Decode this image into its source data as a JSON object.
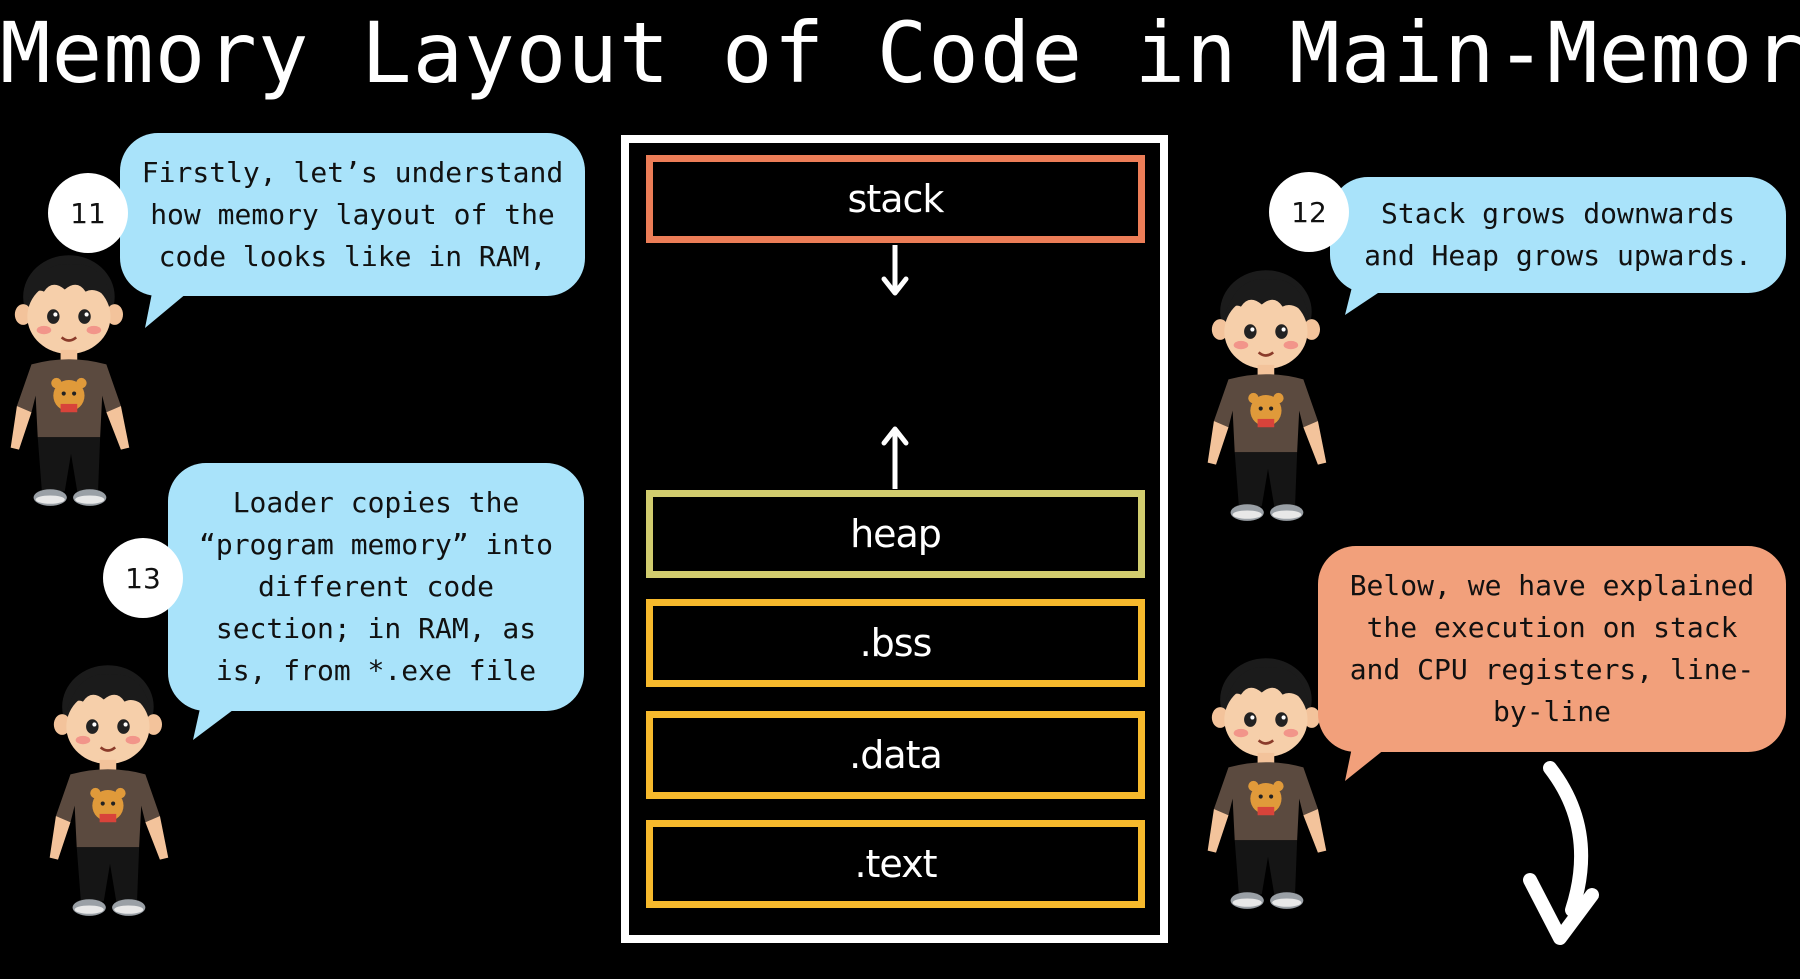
{
  "title": "Memory Layout of Code in Main-Memory",
  "segments": {
    "stack": "stack",
    "heap": "heap",
    "bss": ".bss",
    "data": ".data",
    "text": ".text"
  },
  "notes": {
    "n11": {
      "number": "11",
      "lines": [
        "Firstly, let’s understand",
        "how memory layout of the",
        "code looks like in RAM,"
      ]
    },
    "n12": {
      "number": "12",
      "lines": [
        "Stack grows downwards",
        "and Heap grows upwards."
      ]
    },
    "n13": {
      "number": "13",
      "lines": [
        "Loader copies the",
        "“program memory” into",
        "different code",
        "section; in RAM, as",
        "is, from *.exe file"
      ]
    },
    "n14": {
      "lines": [
        "Below, we have explained",
        "the execution on stack",
        "and CPU registers, line-",
        "by-line"
      ]
    }
  },
  "colors": {
    "stack": "#ec7d57",
    "heap": "#d1cc6e",
    "static": "#f6b92c",
    "bubble_blue": "#a9e3fa",
    "bubble_orange": "#f2a07b"
  }
}
